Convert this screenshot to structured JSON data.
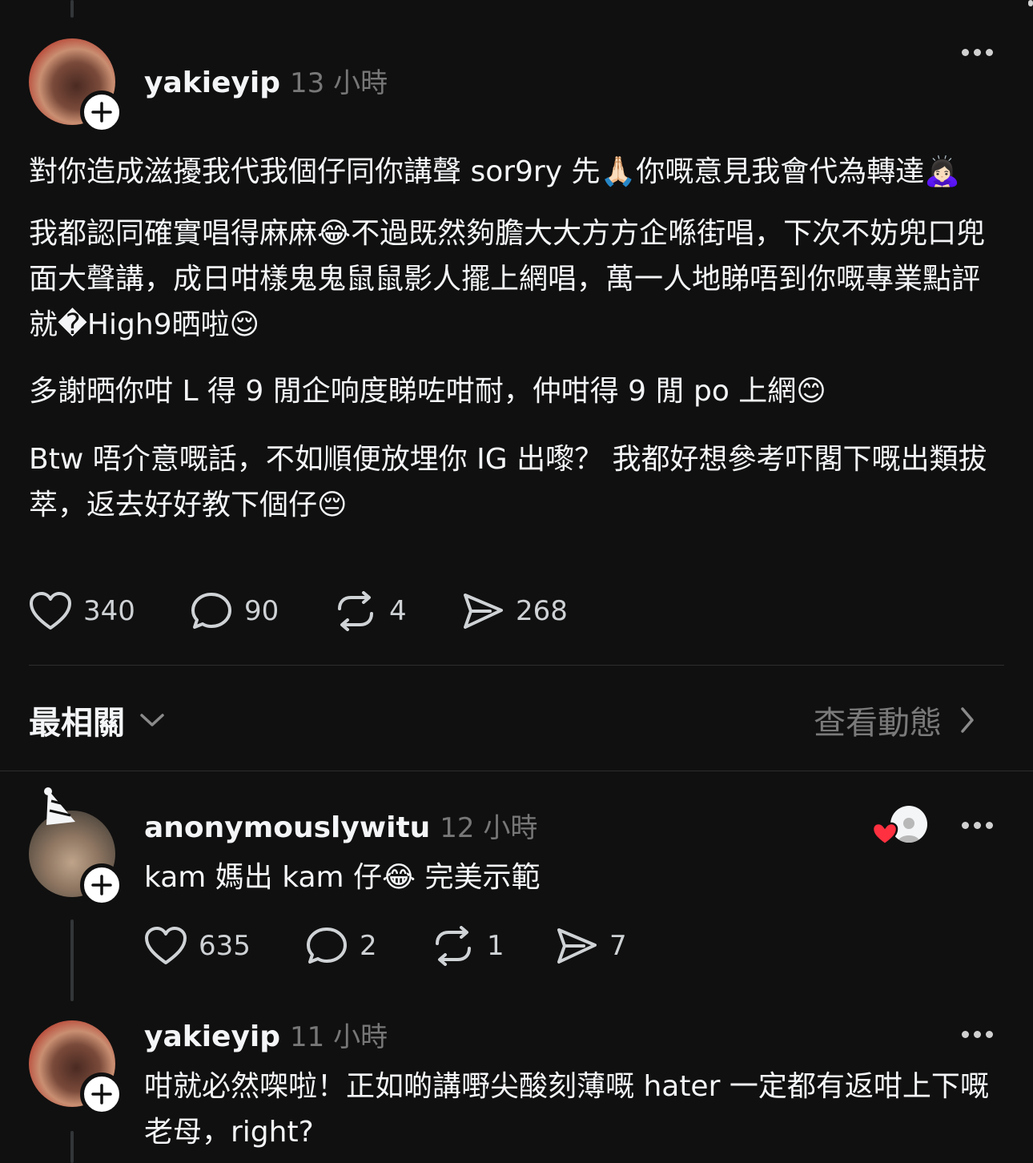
{
  "post": {
    "username": "yakieyip",
    "time": "13 小時",
    "paragraphs": [
      "對你造成滋擾我代我個仔同你講聲 sor9ry 先🙏🏻你嘅意見我會代為轉達🙇🏻‍♀️",
      "我都認同確實唱得麻麻😂不過既然夠膽大大方方企喺街唱，下次不妨兜口兜面大聲講，成日咁樣鬼鬼鼠鼠影人擺上網唱，萬一人地睇唔到你嘅專業點評就�High9晒啦😌",
      "多謝晒你咁 L 得 9 閒企响度睇咗咁耐，仲咁得 9 閒 po 上網😊",
      "Btw 唔介意嘅話，不如順便放埋你 IG 出嚟？ 我都好想參考吓閣下嘅出類拔萃，返去好好教下個仔😔"
    ],
    "likes": "340",
    "comments": "90",
    "reposts": "4",
    "shares": "268"
  },
  "sort_bar": {
    "sort_label": "最相關",
    "activity_link": "查看動態"
  },
  "replies": [
    {
      "username": "anonymouslywitu",
      "time": "12 小時",
      "text": "kam 媽出 kam 仔😂 完美示範",
      "likes": "635",
      "comments": "2",
      "reposts": "1",
      "shares": "7"
    },
    {
      "username": "yakieyip",
      "time": "11 小時",
      "text": "咁就必然㗎啦！正如啲講嘢尖酸刻薄嘅 hater 一定都有返咁上下嘅老母，right?"
    }
  ],
  "icons": {
    "like": "heart-icon",
    "comment": "speech-bubble-icon",
    "repost": "repost-icon",
    "share": "paper-plane-icon",
    "more": "more-dots-icon",
    "follow": "plus-icon",
    "chevron_down": "chevron-down-icon",
    "chevron_right": "chevron-right-icon",
    "liked_by_author": "heart-badge-icon"
  },
  "colors": {
    "background": "#101010",
    "text": "#f3f5f7",
    "secondary": "#777777",
    "like_red": "#ff3040"
  }
}
